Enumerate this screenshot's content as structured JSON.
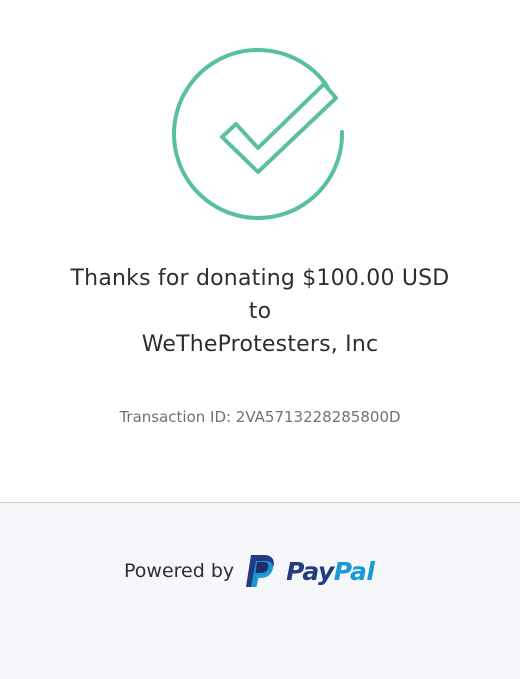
{
  "confirmation": {
    "icon": "check-circle-icon",
    "icon_color": "#58c19b",
    "line1": "Thanks for donating $100.00 USD",
    "line2": "to",
    "line3": "WeTheProtesters, Inc",
    "transaction": "Transaction ID: 2VA5713228285800D"
  },
  "footer": {
    "powered_label": "Powered by",
    "brand_part1": "Pay",
    "brand_part2": "Pal",
    "brand_color_dark": "#253b80",
    "brand_color_light": "#179bd7",
    "background": "#f5f7fa"
  }
}
